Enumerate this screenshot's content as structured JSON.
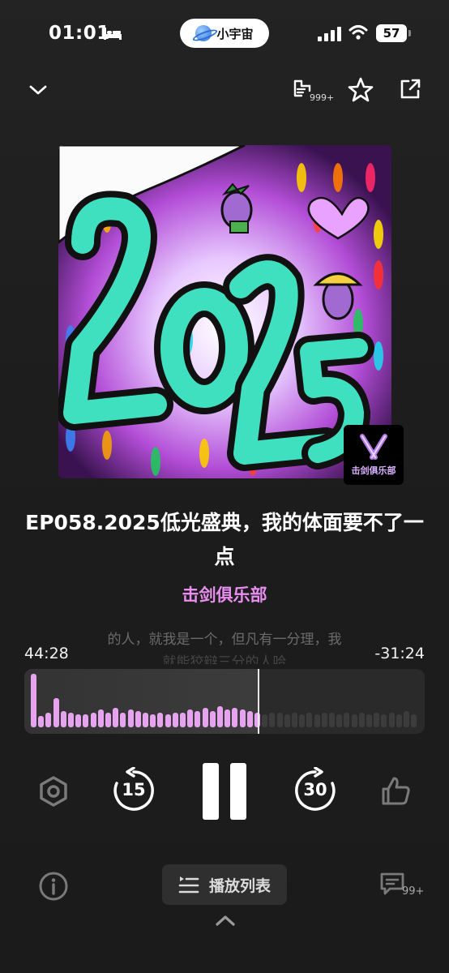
{
  "status_bar": {
    "time": "01:01",
    "app_name": "小宇宙",
    "battery": "57"
  },
  "toolbar": {
    "archive_count": "999+"
  },
  "cover": {
    "badge_text": "击剑俱乐部",
    "art_text": "2025"
  },
  "episode": {
    "title": "EP058.2025低光盛典，我的体面要不了一点",
    "podcast": "击剑俱乐部"
  },
  "transcript": {
    "line1": "的人，就我是一个，但凡有一分理，我",
    "line2": "就能狡辩三分的人哈"
  },
  "progress": {
    "elapsed": "44:28",
    "remaining": "-31:24",
    "fraction_played": 0.586
  },
  "controls": {
    "skip_back": "15",
    "skip_forward": "30"
  },
  "bottom": {
    "playlist_label": "播放列表",
    "comment_count": "99+"
  },
  "colors": {
    "accent": "#e98ef0",
    "waveform_played": "#e7a3ef",
    "waveform_unplayed": "#3c3c3c",
    "background": "#1d1d1d"
  },
  "icons": [
    "bed-icon",
    "planet-icon",
    "signal-icon",
    "wifi-icon",
    "chevron-down-icon",
    "archive-icon",
    "star-icon",
    "share-icon",
    "speed-icon",
    "rewind-15-icon",
    "pause-icon",
    "forward-30-icon",
    "thumbs-up-icon",
    "info-icon",
    "playlist-icon",
    "comment-icon",
    "chevron-up-icon"
  ]
}
